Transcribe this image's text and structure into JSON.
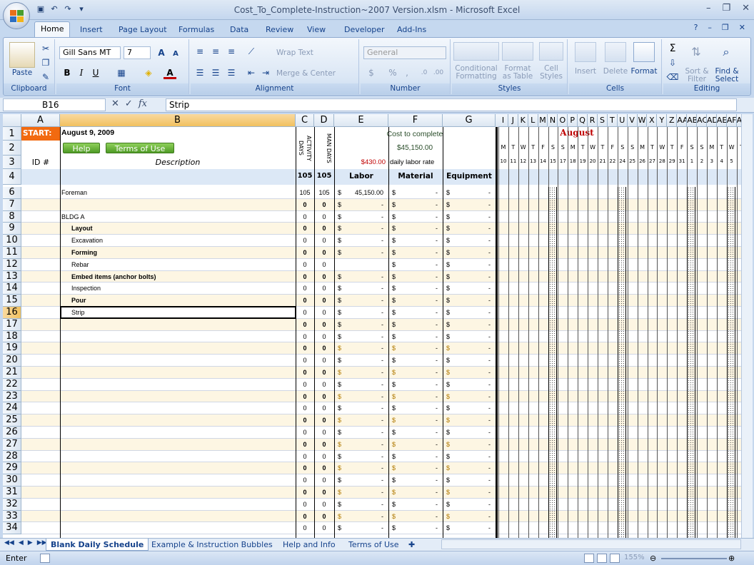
{
  "window": {
    "title": "Cost_To_Complete-Instruction~2007 Version.xlsm - Microsoft Excel",
    "controls": [
      "–",
      "❐",
      "✕"
    ]
  },
  "ribbon_tabs": [
    "Home",
    "Insert",
    "Page Layout",
    "Formulas",
    "Data",
    "Review",
    "View",
    "Developer",
    "Add-Ins"
  ],
  "ribbon_right": [
    "?",
    "–",
    "❐",
    "✕"
  ],
  "ribbon": {
    "clipboard": {
      "paste": "Paste",
      "label": "Clipboard"
    },
    "font": {
      "name": "Gill Sans MT",
      "size": "7",
      "label": "Font",
      "grow": "A",
      "shrink": "A",
      "bold": "B",
      "italic": "I",
      "underline": "U",
      "color": "A"
    },
    "alignment": {
      "wrap": "Wrap Text",
      "merge": "Merge & Center",
      "label": "Alignment"
    },
    "number": {
      "format": "General",
      "currency": "$",
      "percent": "%",
      "comma": ",",
      "label": "Number"
    },
    "styles": {
      "conditional": "Conditional Formatting",
      "table": "Format as Table",
      "cell": "Cell Styles",
      "label": "Styles"
    },
    "cells": {
      "insert": "Insert",
      "delete": "Delete",
      "format": "Format",
      "label": "Cells"
    },
    "editing": {
      "sum": "Σ",
      "sort": "Sort & Filter",
      "find": "Find & Select",
      "label": "Editing"
    }
  },
  "formula_bar": {
    "name_box": "B16",
    "content": "Strip",
    "fx": "fx"
  },
  "columns": [
    "A",
    "B",
    "C",
    "D",
    "E",
    "F",
    "G",
    "I",
    "J",
    "K",
    "L",
    "M",
    "N",
    "O",
    "P",
    "Q",
    "R",
    "S",
    "T",
    "U",
    "V",
    "W",
    "X",
    "Y",
    "Z",
    "AA",
    "AB",
    "AC",
    "AD",
    "AE",
    "AF",
    "AG",
    "AH"
  ],
  "sheet_header": {
    "start_label": "START:",
    "start_date": "August 9, 2009",
    "help_button": "Help",
    "terms_button": "Terms of Use",
    "activity_days": "ACTIVITY DAYS",
    "man_days": "MAN DAYS",
    "cost_to_complete": "Cost to complete",
    "cost_total": "$45,150.00",
    "labor_rate_value": "$430.00",
    "labor_rate_label": "daily labor rate",
    "id_label": "ID #",
    "description_label": "Description",
    "total_activity": "105",
    "total_man": "105",
    "labor_label": "Labor",
    "material_label": "Material",
    "equipment_label": "Equipment",
    "month": "August",
    "weekdays": [
      "M",
      "T",
      "W",
      "T",
      "F",
      "S",
      "S",
      "M",
      "T",
      "W",
      "T",
      "F",
      "S",
      "S",
      "M",
      "T",
      "W",
      "T",
      "F",
      "S",
      "S",
      "M",
      "T",
      "W",
      "T",
      "F",
      "S"
    ],
    "day_numbers": [
      "10",
      "11",
      "12",
      "13",
      "14",
      "15",
      "17",
      "18",
      "19",
      "20",
      "21",
      "22",
      "24",
      "25",
      "26",
      "27",
      "28",
      "29",
      "31",
      "1",
      "2",
      "3",
      "4",
      "5"
    ]
  },
  "rows": [
    {
      "num": "6",
      "desc": "Foreman",
      "indent": false,
      "bold": false,
      "c": "105",
      "d": "105",
      "labor": "45,150.00",
      "mat": "-",
      "eq": "-"
    },
    {
      "num": "7",
      "desc": "",
      "indent": false,
      "bold": true,
      "c": "0",
      "d": "0",
      "labor": "-",
      "mat": "-",
      "eq": "-"
    },
    {
      "num": "8",
      "desc": "BLDG A",
      "indent": false,
      "bold": false,
      "c": "0",
      "d": "0",
      "labor": "-",
      "mat": "-",
      "eq": "-"
    },
    {
      "num": "9",
      "desc": "Layout",
      "indent": true,
      "bold": true,
      "c": "0",
      "d": "0",
      "labor": "-",
      "mat": "-",
      "eq": "-"
    },
    {
      "num": "10",
      "desc": "Excavation",
      "indent": true,
      "bold": false,
      "c": "0",
      "d": "0",
      "labor": "-",
      "mat": "-",
      "eq": "-"
    },
    {
      "num": "11",
      "desc": "Forming",
      "indent": true,
      "bold": true,
      "c": "0",
      "d": "0",
      "labor": "-",
      "mat": "-",
      "eq": "-"
    },
    {
      "num": "12",
      "desc": "Rebar",
      "indent": true,
      "bold": false,
      "c": "0",
      "d": "0",
      "labor": "",
      "mat": "-",
      "eq": "-"
    },
    {
      "num": "13",
      "desc": "Embed items (anchor bolts)",
      "indent": true,
      "bold": true,
      "c": "0",
      "d": "0",
      "labor": "-",
      "mat": "-",
      "eq": "-"
    },
    {
      "num": "14",
      "desc": "Inspection",
      "indent": true,
      "bold": false,
      "c": "0",
      "d": "0",
      "labor": "-",
      "mat": "-",
      "eq": "-"
    },
    {
      "num": "15",
      "desc": "Pour",
      "indent": true,
      "bold": true,
      "c": "0",
      "d": "0",
      "labor": "-",
      "mat": "-",
      "eq": "-"
    },
    {
      "num": "16",
      "desc": "Strip",
      "indent": true,
      "bold": false,
      "c": "0",
      "d": "0",
      "labor": "-",
      "mat": "-",
      "eq": "-"
    },
    {
      "num": "17",
      "desc": "",
      "indent": false,
      "bold": true,
      "c": "0",
      "d": "0",
      "labor": "-",
      "mat": "-",
      "eq": "-"
    },
    {
      "num": "18",
      "desc": "",
      "indent": false,
      "bold": false,
      "c": "0",
      "d": "0",
      "labor": "-",
      "mat": "-",
      "eq": "-"
    },
    {
      "num": "19",
      "desc": "",
      "indent": false,
      "bold": true,
      "c": "0",
      "d": "0",
      "labor": "-",
      "mat": "-",
      "eq": "-"
    },
    {
      "num": "20",
      "desc": "",
      "indent": false,
      "bold": false,
      "c": "0",
      "d": "0",
      "labor": "-",
      "mat": "-",
      "eq": "-"
    },
    {
      "num": "21",
      "desc": "",
      "indent": false,
      "bold": true,
      "c": "0",
      "d": "0",
      "labor": "-",
      "mat": "-",
      "eq": "-"
    },
    {
      "num": "22",
      "desc": "",
      "indent": false,
      "bold": false,
      "c": "0",
      "d": "0",
      "labor": "-",
      "mat": "-",
      "eq": "-"
    },
    {
      "num": "23",
      "desc": "",
      "indent": false,
      "bold": true,
      "c": "0",
      "d": "0",
      "labor": "-",
      "mat": "-",
      "eq": "-"
    },
    {
      "num": "24",
      "desc": "",
      "indent": false,
      "bold": false,
      "c": "0",
      "d": "0",
      "labor": "-",
      "mat": "-",
      "eq": "-"
    },
    {
      "num": "25",
      "desc": "",
      "indent": false,
      "bold": true,
      "c": "0",
      "d": "0",
      "labor": "-",
      "mat": "-",
      "eq": "-"
    },
    {
      "num": "26",
      "desc": "",
      "indent": false,
      "bold": false,
      "c": "0",
      "d": "0",
      "labor": "-",
      "mat": "-",
      "eq": "-"
    },
    {
      "num": "27",
      "desc": "",
      "indent": false,
      "bold": true,
      "c": "0",
      "d": "0",
      "labor": "-",
      "mat": "-",
      "eq": "-"
    },
    {
      "num": "28",
      "desc": "",
      "indent": false,
      "bold": false,
      "c": "0",
      "d": "0",
      "labor": "-",
      "mat": "-",
      "eq": "-"
    },
    {
      "num": "29",
      "desc": "",
      "indent": false,
      "bold": true,
      "c": "0",
      "d": "0",
      "labor": "-",
      "mat": "-",
      "eq": "-"
    },
    {
      "num": "30",
      "desc": "",
      "indent": false,
      "bold": false,
      "c": "0",
      "d": "0",
      "labor": "-",
      "mat": "-",
      "eq": "-"
    },
    {
      "num": "31",
      "desc": "",
      "indent": false,
      "bold": true,
      "c": "0",
      "d": "0",
      "labor": "-",
      "mat": "-",
      "eq": "-"
    },
    {
      "num": "32",
      "desc": "",
      "indent": false,
      "bold": false,
      "c": "0",
      "d": "0",
      "labor": "-",
      "mat": "-",
      "eq": "-"
    },
    {
      "num": "33",
      "desc": "",
      "indent": false,
      "bold": true,
      "c": "0",
      "d": "0",
      "labor": "-",
      "mat": "-",
      "eq": "-"
    },
    {
      "num": "34",
      "desc": "",
      "indent": false,
      "bold": false,
      "c": "0",
      "d": "0",
      "labor": "-",
      "mat": "-",
      "eq": "-"
    }
  ],
  "sheet_tabs": [
    "Blank Daily Schedule",
    "Example & Instruction Bubbles",
    "Help and Info",
    "Terms of Use"
  ],
  "status": {
    "mode": "Enter",
    "zoom": "155%"
  },
  "colors": {
    "start": "#f26a10",
    "month": "#c00000",
    "button": "#5fa832",
    "alt_row": "#fdf6e3",
    "selected_header": "#f1c15f"
  }
}
